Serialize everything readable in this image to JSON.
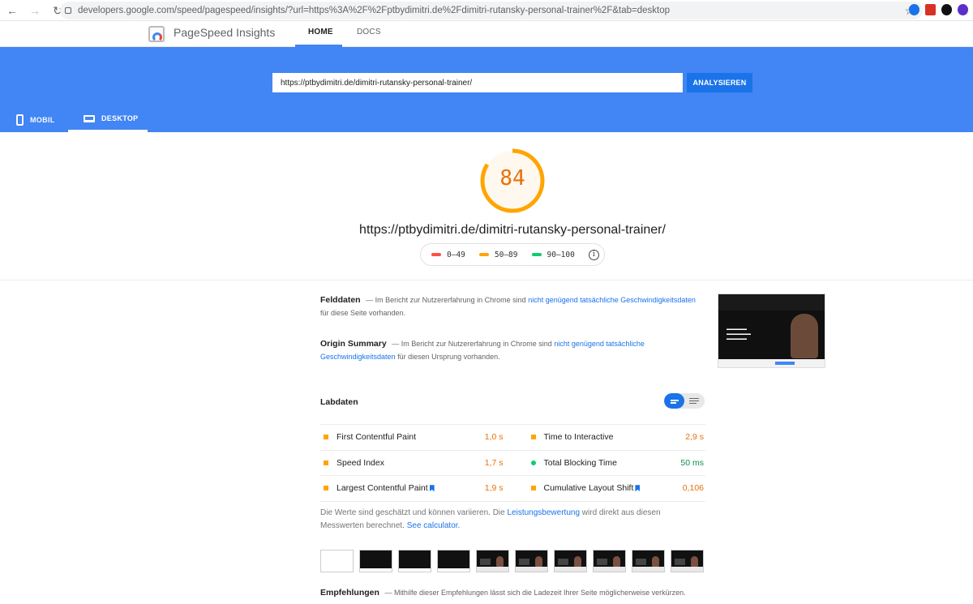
{
  "browser": {
    "url": "developers.google.com/speed/pagespeed/insights/?url=https%3A%2F%2Fptbydimitri.de%2Fdimitri-rutansky-personal-trainer%2F&tab=desktop",
    "back_icon": "←",
    "forward_icon": "→",
    "reload_icon": "↻",
    "star_icon": "☆"
  },
  "header": {
    "title": "PageSpeed Insights",
    "tabs": [
      "HOME",
      "DOCS"
    ]
  },
  "hero": {
    "url_value": "https://ptbydimitri.de/dimitri-rutansky-personal-trainer/",
    "analyze_label": "ANALYSIEREN",
    "device_tabs": [
      "MOBIL",
      "DESKTOP"
    ]
  },
  "score": {
    "value": "84",
    "fraction": 0.84,
    "url": "https://ptbydimitri.de/dimitri-rutansky-personal-trainer/",
    "legend": [
      "0–49",
      "50–89",
      "90–100"
    ],
    "info_icon": "i",
    "colors": {
      "fail": "#ff4e42",
      "average": "#ffa400",
      "pass": "#0cce6b"
    }
  },
  "field": {
    "title": "Felddaten",
    "text_a": "— Im Bericht zur Nutzererfahrung in Chrome sind",
    "link": "nicht genügend tatsächliche Geschwindigkeitsdaten",
    "text_b": "für diese Seite vorhanden."
  },
  "origin": {
    "title": "Origin Summary",
    "text_a": "— Im Bericht zur Nutzererfahrung in Chrome sind",
    "link": "nicht genügend tatsächliche Geschwindigkeitsdaten",
    "text_b": "für diesen Ursprung vorhanden."
  },
  "lab": {
    "title": "Labdaten",
    "metrics": [
      {
        "label": "First Contentful Paint",
        "value": "1,0 s",
        "status": "average",
        "bookmark": false
      },
      {
        "label": "Time to Interactive",
        "value": "2,9 s",
        "status": "average",
        "bookmark": false
      },
      {
        "label": "Speed Index",
        "value": "1,7 s",
        "status": "average",
        "bookmark": false
      },
      {
        "label": "Total Blocking Time",
        "value": "50 ms",
        "status": "pass",
        "bookmark": false
      },
      {
        "label": "Largest Contentful Paint",
        "value": "1,9 s",
        "status": "average",
        "bookmark": true
      },
      {
        "label": "Cumulative Layout Shift",
        "value": "0,106",
        "status": "average",
        "bookmark": true
      }
    ],
    "note_a": "Die Werte sind geschätzt und können variieren. Die",
    "note_link1": "Leistungsbewertung",
    "note_b": "wird direkt aus diesen Messwerten berechnet.",
    "note_link2": "See calculator."
  },
  "recommendations": {
    "title": "Empfehlungen",
    "text": "— Mithilfe dieser Empfehlungen lässt sich die Ladezeit Ihrer Seite möglicherweise verkürzen."
  },
  "accent": "#4285f4"
}
